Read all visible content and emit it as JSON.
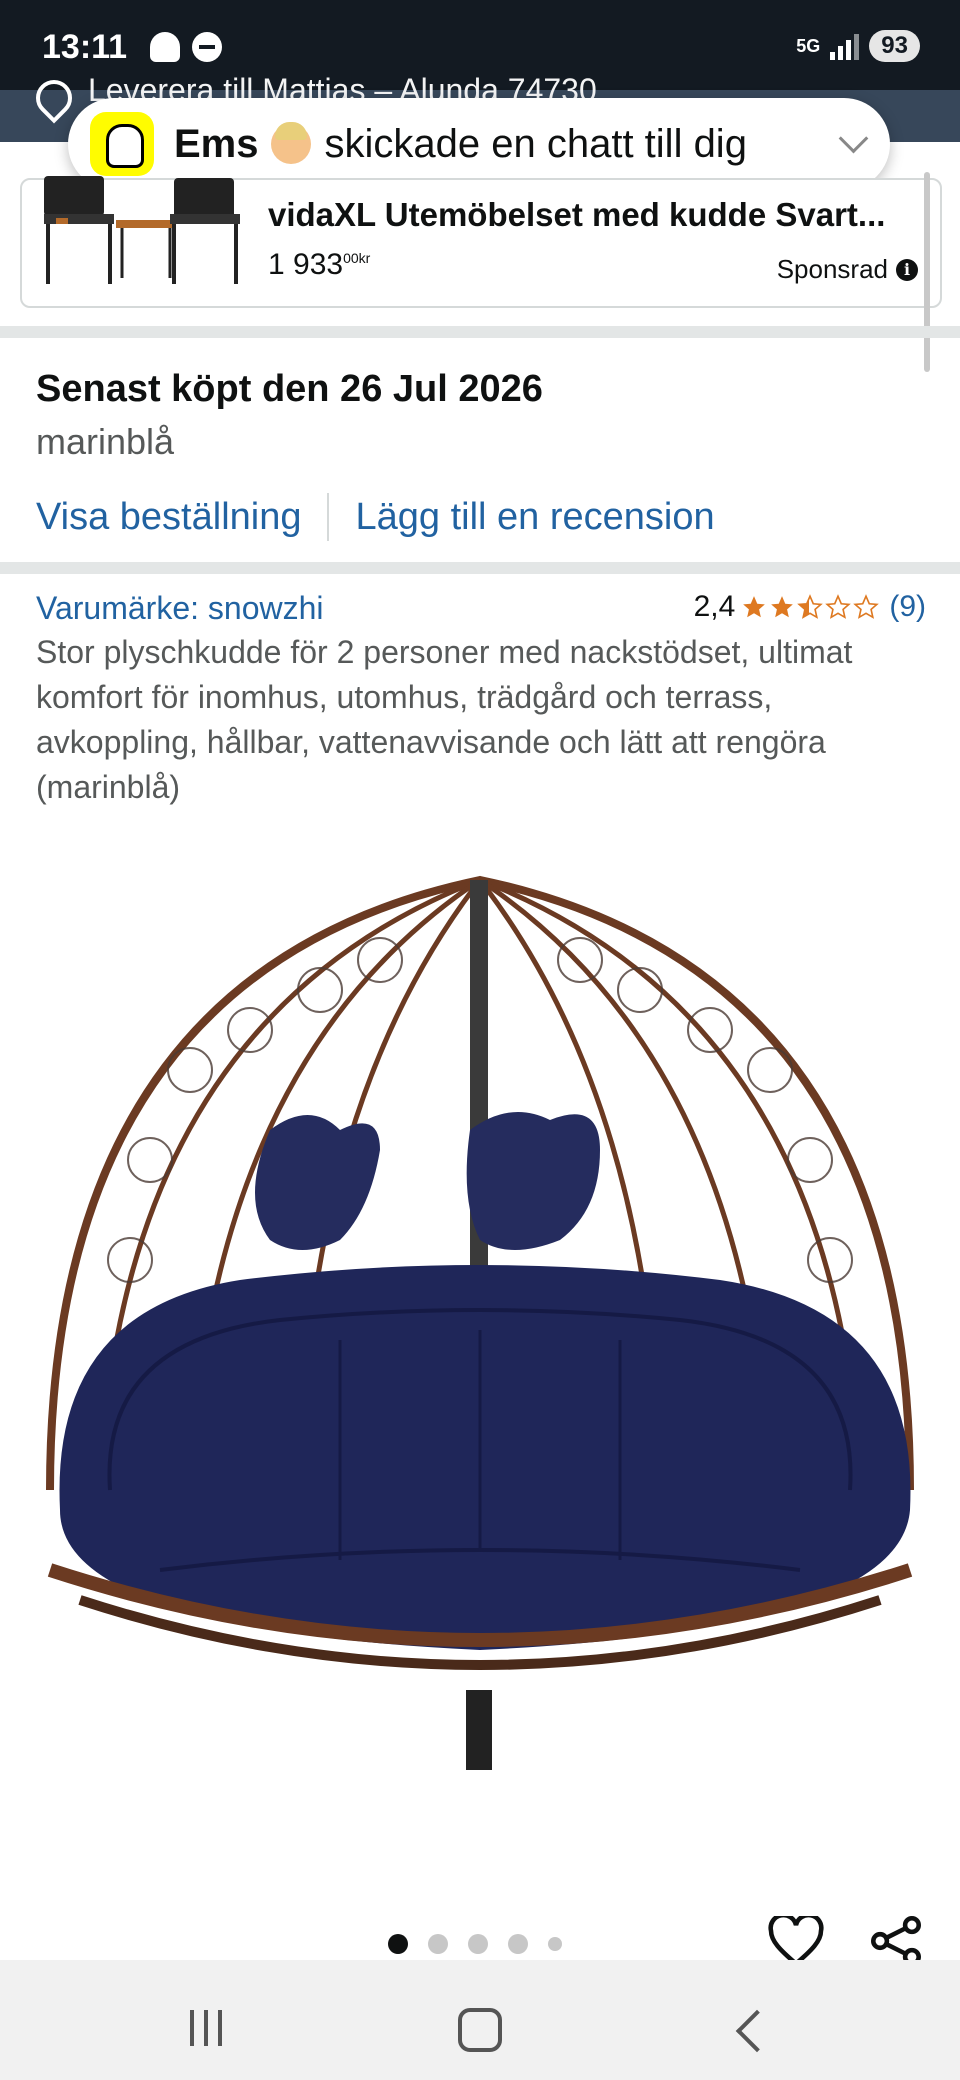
{
  "status_bar": {
    "time": "13:11",
    "network": "5G",
    "battery": "93"
  },
  "delivery": {
    "text": "Leverera till Mattias – Alunda 74730"
  },
  "notification": {
    "app_name": "Ems",
    "message": "skickade en chatt till dig"
  },
  "sponsored_ad": {
    "title": "vidaXL Utemöbelset med kudde Svart...",
    "price_whole": "1 933",
    "price_fraction": "00",
    "currency": "kr",
    "sponsored_label": "Sponsrad"
  },
  "order": {
    "last_bought": "Senast köpt den 26 Jul 2026",
    "variant": "marinblå",
    "view_order_link": "Visa beställning",
    "add_review_link": "Lägg till en recension"
  },
  "product": {
    "brand": "Varumärke: snowzhi",
    "rating": "2,4",
    "rating_stars": 2.4,
    "rating_count": "(9)",
    "description": "Stor plyschkudde för 2 personer med nackstödset, ultimat komfort för inomhus, utomhus, trädgård och terrass, avkoppling, hållbar, vattenavvisande och lätt att rengöra (marinblå)",
    "image_count": 5,
    "active_image": 1
  },
  "colors": {
    "link_blue": "#2162a1",
    "star_orange": "#de7921",
    "cushion_navy": "#1f2659",
    "wicker_brown": "#6b3a22",
    "header_dark": "#131a22"
  },
  "icons": [
    "location-icon",
    "snapchat-icon",
    "chevron-down-icon",
    "info-icon",
    "star-icon",
    "heart-icon",
    "share-icon",
    "recent-apps-icon",
    "home-icon",
    "back-icon"
  ]
}
